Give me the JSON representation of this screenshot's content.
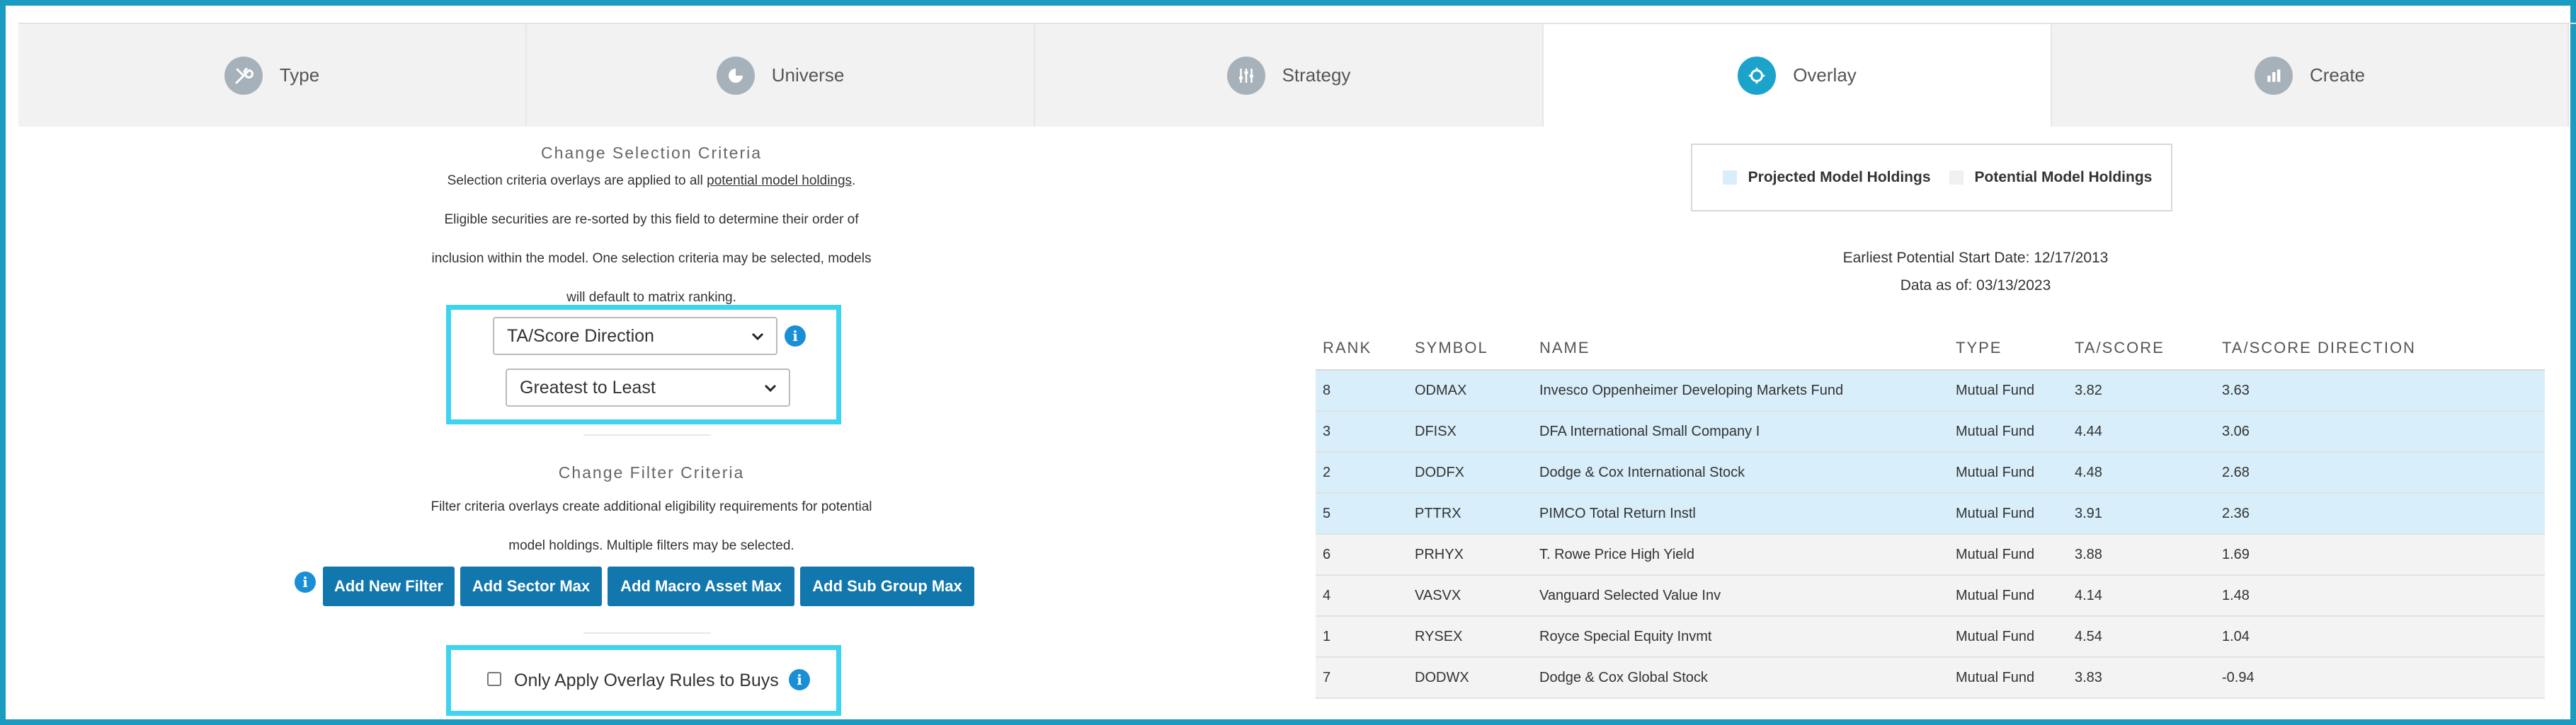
{
  "tabs": [
    {
      "label": "Type",
      "icon": "tools-icon",
      "active": false
    },
    {
      "label": "Universe",
      "icon": "pie-chart-icon",
      "active": false
    },
    {
      "label": "Strategy",
      "icon": "sliders-icon",
      "active": false
    },
    {
      "label": "Overlay",
      "icon": "overlay-icon",
      "active": true
    },
    {
      "label": "Create",
      "icon": "bar-chart-icon",
      "active": false
    }
  ],
  "selection": {
    "title": "Change Selection Criteria",
    "desc_prefix": "Selection criteria overlays are applied to all ",
    "desc_link": "potential model holdings",
    "desc_suffix": ".",
    "desc_2": "Eligible securities are re-sorted by this field to determine their order of",
    "desc_3": "inclusion within the model. One selection criteria may be selected, models",
    "desc_4": "will default to matrix ranking.",
    "field_value": "TA/Score Direction",
    "order_value": "Greatest to Least"
  },
  "filter": {
    "title": "Change Filter Criteria",
    "desc_1": "Filter criteria overlays create additional eligibility requirements for potential",
    "desc_2": "model holdings. Multiple filters may be selected.",
    "buttons": [
      "Add New Filter",
      "Add Sector Max",
      "Add Macro Asset Max",
      "Add Sub Group Max"
    ]
  },
  "overlay_checkbox": {
    "label": "Only Apply Overlay Rules to Buys",
    "checked": false
  },
  "legend": {
    "projected": "Projected Model Holdings",
    "potential": "Potential Model Holdings",
    "projected_color": "#d8eefa",
    "potential_color": "#f0f0f0"
  },
  "meta": {
    "start_date": "Earliest Potential Start Date: 12/17/2013",
    "data_as_of": "Data as of: 03/13/2023"
  },
  "table": {
    "headers": [
      "RANK",
      "SYMBOL",
      "NAME",
      "TYPE",
      "TA/SCORE",
      "TA/SCORE DIRECTION"
    ],
    "rows": [
      {
        "rank": "8",
        "symbol": "ODMAX",
        "name": "Invesco Oppenheimer Developing Markets Fund",
        "type": "Mutual Fund",
        "score": "3.82",
        "direction": "3.63",
        "group": "projected"
      },
      {
        "rank": "3",
        "symbol": "DFISX",
        "name": "DFA International Small Company I",
        "type": "Mutual Fund",
        "score": "4.44",
        "direction": "3.06",
        "group": "projected"
      },
      {
        "rank": "2",
        "symbol": "DODFX",
        "name": "Dodge & Cox International Stock",
        "type": "Mutual Fund",
        "score": "4.48",
        "direction": "2.68",
        "group": "projected"
      },
      {
        "rank": "5",
        "symbol": "PTTRX",
        "name": "PIMCO Total Return Instl",
        "type": "Mutual Fund",
        "score": "3.91",
        "direction": "2.36",
        "group": "projected"
      },
      {
        "rank": "6",
        "symbol": "PRHYX",
        "name": "T. Rowe Price High Yield",
        "type": "Mutual Fund",
        "score": "3.88",
        "direction": "1.69",
        "group": "potential"
      },
      {
        "rank": "4",
        "symbol": "VASVX",
        "name": "Vanguard Selected Value Inv",
        "type": "Mutual Fund",
        "score": "4.14",
        "direction": "1.48",
        "group": "potential"
      },
      {
        "rank": "1",
        "symbol": "RYSEX",
        "name": "Royce Special Equity Invmt",
        "type": "Mutual Fund",
        "score": "4.54",
        "direction": "1.04",
        "group": "potential"
      },
      {
        "rank": "7",
        "symbol": "DODWX",
        "name": "Dodge & Cox Global Stock",
        "type": "Mutual Fund",
        "score": "3.83",
        "direction": "-0.94",
        "group": "potential"
      }
    ]
  }
}
